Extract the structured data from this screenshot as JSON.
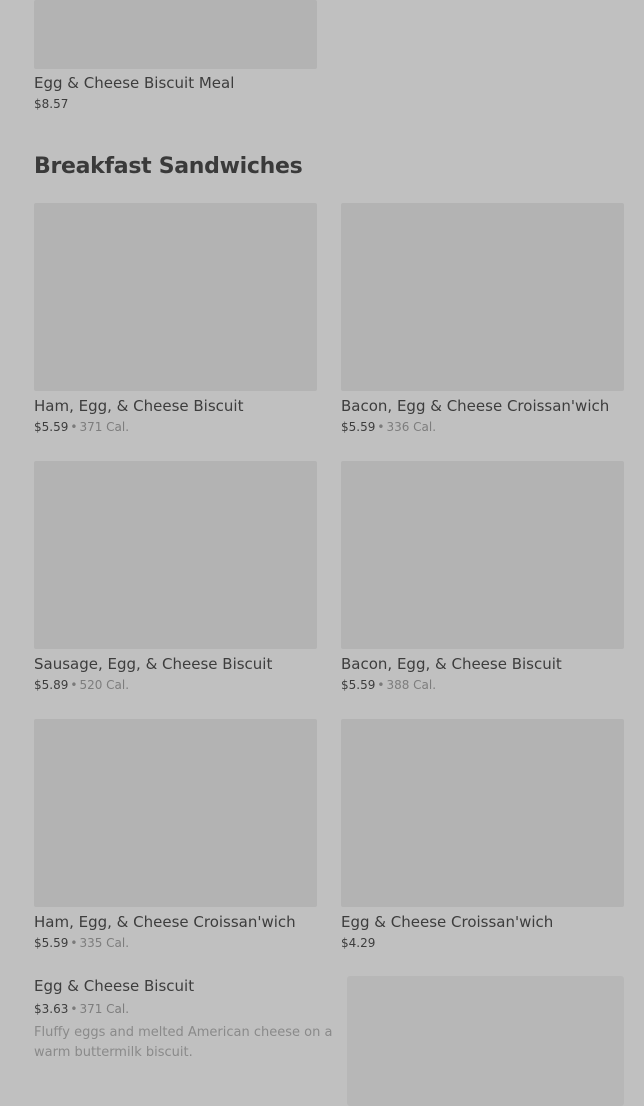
{
  "top_item": {
    "name": "Egg & Cheese Biscuit Meal",
    "price": "$8.57"
  },
  "section": {
    "title": "Breakfast Sandwiches"
  },
  "items": [
    {
      "name": "Ham, Egg, & Cheese Biscuit",
      "price": "$5.59",
      "sep": "•",
      "cal": "371 Cal."
    },
    {
      "name": "Bacon, Egg & Cheese Croissan'wich",
      "price": "$5.59",
      "sep": "•",
      "cal": "336 Cal."
    },
    {
      "name": "Sausage, Egg, & Cheese Biscuit",
      "price": "$5.89",
      "sep": "•",
      "cal": "520 Cal."
    },
    {
      "name": "Bacon, Egg, & Cheese Biscuit",
      "price": "$5.59",
      "sep": "•",
      "cal": "388 Cal."
    },
    {
      "name": "Ham, Egg, & Cheese Croissan'wich",
      "price": "$5.59",
      "sep": "•",
      "cal": "335 Cal."
    },
    {
      "name": "Egg & Cheese Croissan'wich",
      "price": "$4.29"
    }
  ],
  "featured_item": {
    "name": "Egg & Cheese Biscuit",
    "price": "$3.63",
    "sep": "•",
    "cal": "371 Cal.",
    "description": "Fluffy eggs and melted American cheese on a warm buttermilk biscuit."
  }
}
